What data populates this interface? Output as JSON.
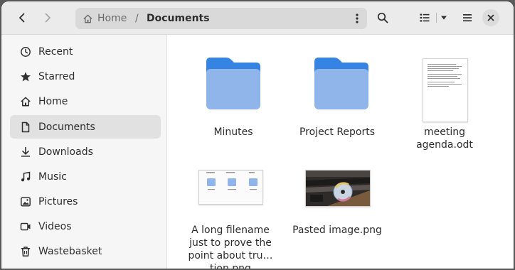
{
  "window": {
    "accent": "#3584e4",
    "folder_color": "#8fb5ea"
  },
  "headerbar": {
    "back_icon": "go-previous-icon",
    "forward_icon": "go-next-icon",
    "path": {
      "home_label": "Home",
      "separator": "/",
      "current": "Documents"
    },
    "search_icon": "search-icon",
    "view_icon": "list-view-icon",
    "menu_icon": "hamburger-menu-icon",
    "close_icon": "close-icon"
  },
  "sidebar": {
    "items": [
      {
        "label": "Recent",
        "icon": "clock-icon",
        "active": false
      },
      {
        "label": "Starred",
        "icon": "star-icon",
        "active": false
      },
      {
        "label": "Home",
        "icon": "home-icon",
        "active": false
      },
      {
        "label": "Documents",
        "icon": "document-icon",
        "active": true
      },
      {
        "label": "Downloads",
        "icon": "download-icon",
        "active": false
      },
      {
        "label": "Music",
        "icon": "music-icon",
        "active": false
      },
      {
        "label": "Pictures",
        "icon": "picture-icon",
        "active": false
      },
      {
        "label": "Videos",
        "icon": "video-icon",
        "active": false
      },
      {
        "label": "Wastebasket",
        "icon": "trash-icon",
        "active": false
      }
    ]
  },
  "files": [
    {
      "name": "Minutes",
      "type": "folder"
    },
    {
      "name": "Project Reports",
      "type": "folder"
    },
    {
      "name": "meeting agenda.odt",
      "type": "document"
    },
    {
      "name": "A long filename just to prove the point about tru… tion.png",
      "type": "image"
    },
    {
      "name": "Pasted image.png",
      "type": "image"
    }
  ]
}
